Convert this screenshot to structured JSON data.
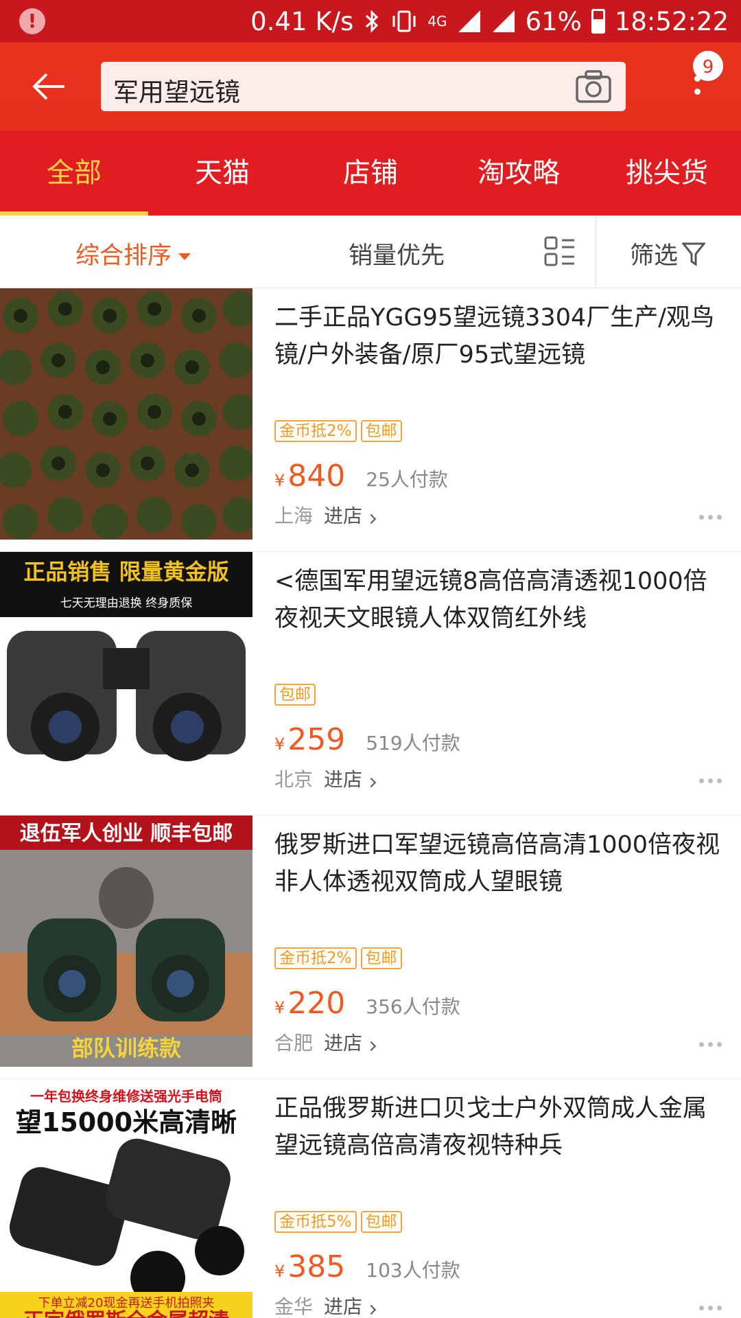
{
  "status_bar": {
    "speed": "0.41 K/s",
    "network": "4G",
    "battery": "61%",
    "time": "18:52:22"
  },
  "header": {
    "search_text": "军用望远镜",
    "notification_count": "9"
  },
  "tabs": [
    "全部",
    "天猫",
    "店铺",
    "淘攻略",
    "挑尖货"
  ],
  "sort": {
    "main": "综合排序",
    "sales": "销量优先",
    "filter": "筛选"
  },
  "products": [
    {
      "title": "二手正品YGG95望远镜3304厂生产/观鸟镜/户外装备/原厂95式望远镜",
      "tags": [
        "金币抵2%",
        "包邮"
      ],
      "currency": "¥",
      "price": "840",
      "paid": "25人付款",
      "location": "上海",
      "enter": "进店"
    },
    {
      "title": "<德国军用望远镜8高倍高清透视1000倍夜视天文眼镜人体双筒红外线",
      "tags": [
        "包邮"
      ],
      "currency": "¥",
      "price": "259",
      "paid": "519人付款",
      "location": "北京",
      "enter": "进店",
      "banner_top": "正品销售  限量黄金版",
      "banner_sub": "七天无理由退换    终身质保"
    },
    {
      "title": "俄罗斯进口军望远镜高倍高清1000倍夜视非人体透视双筒成人望眼镜",
      "tags": [
        "金币抵2%",
        "包邮"
      ],
      "currency": "¥",
      "price": "220",
      "paid": "356人付款",
      "location": "合肥",
      "enter": "进店",
      "banner_top": "退伍军人创业 顺丰包邮",
      "banner_bottom": "部队训练款"
    },
    {
      "title": "正品俄罗斯进口贝戈士户外双筒成人金属望远镜高倍高清夜视特种兵",
      "tags": [
        "金币抵5%",
        "包邮"
      ],
      "currency": "¥",
      "price": "385",
      "paid": "103人付款",
      "location": "金华",
      "enter": "进店",
      "banner_top": "一年包换终身维修送强光手电筒",
      "banner_mid": "望15000米高清晰",
      "banner_bottom1": "下单立减20现金再送手机拍照夹",
      "banner_bottom2": "正宗俄罗斯全金属超清"
    }
  ],
  "colors": {
    "header_red": "#e5301c",
    "tab_red": "#e01d21",
    "accent_orange": "#f05a21",
    "tab_active": "#ffd24a"
  }
}
